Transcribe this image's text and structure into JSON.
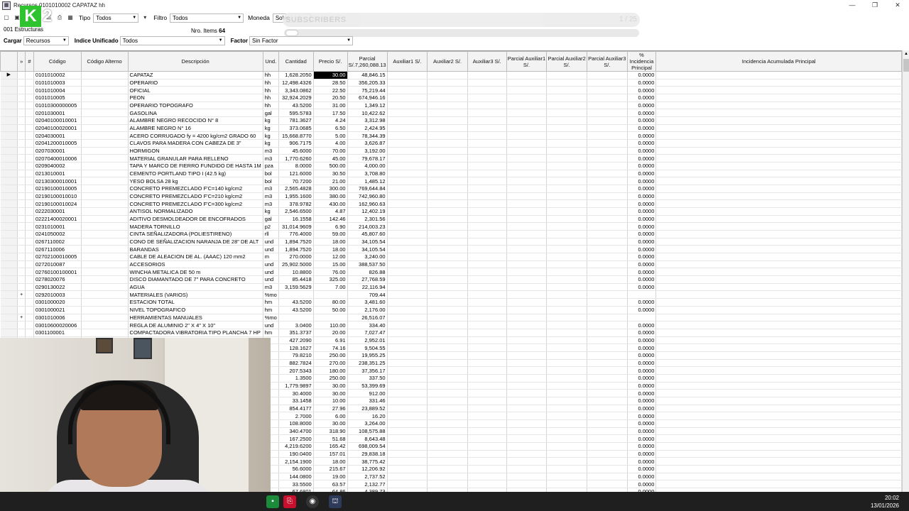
{
  "window": {
    "title": "Recursos 0101010002 CAPATAZ hh",
    "minimize": "—",
    "maximize": "❐",
    "close": "✕"
  },
  "logo": {
    "letter1": "K",
    "letter2": "2"
  },
  "toolbar": {
    "tipo_label": "Tipo",
    "tipo_value": "Todos",
    "filtro_label": "Filtro",
    "filtro_value": "Todos",
    "moneda_label": "Moneda",
    "moneda_value": "Soles"
  },
  "overlay": {
    "subscribers": "SUBSCRIBERS",
    "count": "1 / 25"
  },
  "estructuras": "001 Estructuras",
  "nro_items_label": "Nro. Items",
  "nro_items_value": "64",
  "filters": {
    "cargar_label": "Cargar",
    "cargar_value": "Recursos",
    "indice_label": "Indice Unificado",
    "indice_value": "Todos",
    "factor_label": "Factor",
    "factor_value": "Sin Factor"
  },
  "columns": [
    "»",
    "#",
    "Código",
    "Código Alterno",
    "Descripción",
    "Und.",
    "Cantidad",
    "Precio S/.",
    "Parcial S/.7,260,088.13",
    "Auxiliar1 S/.",
    "Auxiliar2 S/.",
    "Auxiliar3 S/.",
    "Parcial Auxiliar1 S/.",
    "Parcial Auxiliar2 S/.",
    "Parcial Auxiliar3 S/.",
    "% Incidencia Principal",
    "Incidencia Acumulada Principal"
  ],
  "rows": [
    {
      "exp": "",
      "code": "0101010002",
      "desc": "CAPATAZ",
      "und": "hh",
      "qty": "1,628.2050",
      "price": "30.00",
      "parcial": "48,846.15",
      "inc": "0.0000"
    },
    {
      "exp": "",
      "code": "0101010003",
      "desc": "OPERARIO",
      "und": "hh",
      "qty": "12,498.4326",
      "price": "28.50",
      "parcial": "356,205.33",
      "inc": "0.0000"
    },
    {
      "exp": "",
      "code": "0101010004",
      "desc": "OFICIAL",
      "und": "hh",
      "qty": "3,343.0862",
      "price": "22.50",
      "parcial": "75,219.44",
      "inc": "0.0000"
    },
    {
      "exp": "",
      "code": "0101010005",
      "desc": "PEON",
      "und": "hh",
      "qty": "32,924.2029",
      "price": "20.50",
      "parcial": "674,946.16",
      "inc": "0.0000"
    },
    {
      "exp": "",
      "code": "01010300000005",
      "desc": "OPERARIO TOPOGRAFO",
      "und": "hh",
      "qty": "43.5200",
      "price": "31.00",
      "parcial": "1,349.12",
      "inc": "0.0000"
    },
    {
      "exp": "",
      "code": "0201030001",
      "desc": "GASOLINA",
      "und": "gal",
      "qty": "595.5783",
      "price": "17.50",
      "parcial": "10,422.62",
      "inc": "0.0000"
    },
    {
      "exp": "",
      "code": "02040100010001",
      "desc": "ALAMBRE NEGRO RECOCIDO N° 8",
      "und": "kg",
      "qty": "781.3627",
      "price": "4.24",
      "parcial": "3,312.98",
      "inc": "0.0000"
    },
    {
      "exp": "",
      "code": "02040100020001",
      "desc": "ALAMBRE NEGRO N° 16",
      "und": "kg",
      "qty": "373.0685",
      "price": "6.50",
      "parcial": "2,424.95",
      "inc": "0.0000"
    },
    {
      "exp": "",
      "code": "0204030001",
      "desc": "ACERO CORRUGADO fy = 4200 kg/cm2 GRADO 60",
      "und": "kg",
      "qty": "15,668.8770",
      "price": "5.00",
      "parcial": "78,344.39",
      "inc": "0.0000"
    },
    {
      "exp": "",
      "code": "02041200010005",
      "desc": "CLAVOS PARA MADERA CON CABEZA DE 3\"",
      "und": "kg",
      "qty": "906.7175",
      "price": "4.00",
      "parcial": "3,626.87",
      "inc": "0.0000"
    },
    {
      "exp": "",
      "code": "0207030001",
      "desc": "HORMIGON",
      "und": "m3",
      "qty": "45.6000",
      "price": "70.00",
      "parcial": "3,192.00",
      "inc": "0.0000"
    },
    {
      "exp": "",
      "code": "02070400010006",
      "desc": "MATERIAL GRANULAR PARA RELLENO",
      "und": "m3",
      "qty": "1,770.6260",
      "price": "45.00",
      "parcial": "79,678.17",
      "inc": "0.0000"
    },
    {
      "exp": "",
      "code": "0209040002",
      "desc": "TAPA Y MARCO DE FIERRO FUNDIDO DE HASTA 1M",
      "und": "pza",
      "qty": "8.0000",
      "price": "500.00",
      "parcial": "4,000.00",
      "inc": "0.0000"
    },
    {
      "exp": "",
      "code": "0213010001",
      "desc": "CEMENTO PORTLAND TIPO I (42.5 kg)",
      "und": "bol",
      "qty": "121.6000",
      "price": "30.50",
      "parcial": "3,708.80",
      "inc": "0.0000"
    },
    {
      "exp": "",
      "code": "02130300010001",
      "desc": "YESO BOLSA 28 kg",
      "und": "bol",
      "qty": "70.7200",
      "price": "21.00",
      "parcial": "1,485.12",
      "inc": "0.0000"
    },
    {
      "exp": "",
      "code": "02190100010005",
      "desc": "CONCRETO PREMEZCLADO F'C=140 kg/cm2",
      "und": "m3",
      "qty": "2,565.4828",
      "price": "300.00",
      "parcial": "769,644.84",
      "inc": "0.0000"
    },
    {
      "exp": "",
      "code": "02190100010010",
      "desc": "CONCRETO PREMEZCLADO F'C=210 kg/cm2",
      "und": "m3",
      "qty": "1,955.1600",
      "price": "380.00",
      "parcial": "742,960.80",
      "inc": "0.0000"
    },
    {
      "exp": "",
      "code": "02190100010024",
      "desc": "CONCRETO PREMEZCLADO F'C=300 kg/cm2",
      "und": "m3",
      "qty": "378.9782",
      "price": "430.00",
      "parcial": "162,960.63",
      "inc": "0.0000"
    },
    {
      "exp": "",
      "code": "0222030001",
      "desc": "ANTISOL NORMALIZADO",
      "und": "kg",
      "qty": "2,546.6500",
      "price": "4.87",
      "parcial": "12,402.19",
      "inc": "0.0000"
    },
    {
      "exp": "",
      "code": "02221400020001",
      "desc": "ADITIVO DESMOLDEADOR DE ENCOFRADOS",
      "und": "gal",
      "qty": "16.1558",
      "price": "142.46",
      "parcial": "2,301.56",
      "inc": "0.0000"
    },
    {
      "exp": "",
      "code": "0231010001",
      "desc": "MADERA TORNILLO",
      "und": "p2",
      "qty": "31,014.9609",
      "price": "6.90",
      "parcial": "214,003.23",
      "inc": "0.0000"
    },
    {
      "exp": "",
      "code": "0241050002",
      "desc": "CINTA SEÑALIZADORA (POLIESTIRENO)",
      "und": "rll",
      "qty": "776.4000",
      "price": "59.00",
      "parcial": "45,807.60",
      "inc": "0.0000"
    },
    {
      "exp": "",
      "code": "0267110002",
      "desc": "CONO DE SEÑALIZACION NARANJA DE 28\" DE ALT",
      "und": "und",
      "qty": "1,894.7520",
      "price": "18.00",
      "parcial": "34,105.54",
      "inc": "0.0000"
    },
    {
      "exp": "",
      "code": "0267110006",
      "desc": "BARANDAS",
      "und": "und",
      "qty": "1,894.7520",
      "price": "18.00",
      "parcial": "34,105.54",
      "inc": "0.0000"
    },
    {
      "exp": "",
      "code": "02702100010005",
      "desc": "CABLE DE ALEACION DE AL. (AAAC) 120 mm2",
      "und": "m",
      "qty": "270.0000",
      "price": "12.00",
      "parcial": "3,240.00",
      "inc": "0.0000"
    },
    {
      "exp": "",
      "code": "0272010087",
      "desc": "ACCESORIOS",
      "und": "und",
      "qty": "25,902.5000",
      "price": "15.00",
      "parcial": "388,537.50",
      "inc": "0.0000"
    },
    {
      "exp": "",
      "code": "02760100100001",
      "desc": "WINCHA METALICA DE 50 m",
      "und": "und",
      "qty": "10.8800",
      "price": "76.00",
      "parcial": "826.88",
      "inc": "0.0000"
    },
    {
      "exp": "",
      "code": "0278020076",
      "desc": "DISCO DIAMANTADO DE 7\" PARA CONCRETO",
      "und": "und",
      "qty": "85.4418",
      "price": "325.00",
      "parcial": "27,768.59",
      "inc": "0.0000"
    },
    {
      "exp": "",
      "code": "0290130022",
      "desc": "AGUA",
      "und": "m3",
      "qty": "3,159.5629",
      "price": "7.00",
      "parcial": "22,116.94",
      "inc": "0.0000"
    },
    {
      "exp": "+",
      "code": "0292010003",
      "desc": "MATERIALES (VARIOS)",
      "und": "%mo",
      "qty": "",
      "price": "",
      "parcial": "709.44",
      "inc": ""
    },
    {
      "exp": "",
      "code": "0301000020",
      "desc": "ESTACION TOTAL",
      "und": "hm",
      "qty": "43.5200",
      "price": "80.00",
      "parcial": "3,481.60",
      "inc": "0.0000"
    },
    {
      "exp": "",
      "code": "0301000021",
      "desc": "NIVEL TOPOGRAFICO",
      "und": "hm",
      "qty": "43.5200",
      "price": "50.00",
      "parcial": "2,176.00",
      "inc": "0.0000"
    },
    {
      "exp": "+",
      "code": "0301010006",
      "desc": "HERRAMIENTAS MANUALES",
      "und": "%mo",
      "qty": "",
      "price": "",
      "parcial": "26,516.07",
      "inc": ""
    },
    {
      "exp": "",
      "code": "03010600020006",
      "desc": "REGLA DE ALUMINIO 2\" X 4\" X 10\"",
      "und": "und",
      "qty": "3.0400",
      "price": "110.00",
      "parcial": "334.40",
      "inc": "0.0000"
    },
    {
      "exp": "",
      "code": "0301100001",
      "desc": "COMPACTADORA VIBRATORIA TIPO PLANCHA 7 HP",
      "und": "hm",
      "qty": "351.3737",
      "price": "20.00",
      "parcial": "7,027.47",
      "inc": "0.0000"
    },
    {
      "exp": "",
      "code": "",
      "desc": "",
      "und": "",
      "qty": "427.2090",
      "price": "6.91",
      "parcial": "2,952.01",
      "inc": "0.0000"
    },
    {
      "exp": "",
      "code": "",
      "desc": "",
      "und": "",
      "qty": "128.1627",
      "price": "74.16",
      "parcial": "9,504.55",
      "inc": "0.0000"
    },
    {
      "exp": "",
      "code": "",
      "desc": "",
      "und": "",
      "qty": "79.8210",
      "price": "250.00",
      "parcial": "19,955.25",
      "inc": "0.0000"
    },
    {
      "exp": "",
      "code": "",
      "desc": "",
      "und": "",
      "qty": "882.7824",
      "price": "270.00",
      "parcial": "238,351.25",
      "inc": "0.0000"
    },
    {
      "exp": "",
      "code": "",
      "desc": "",
      "und": "",
      "qty": "207.5343",
      "price": "180.00",
      "parcial": "37,356.17",
      "inc": "0.0000"
    },
    {
      "exp": "",
      "code": "",
      "desc": "",
      "und": "",
      "qty": "1.3500",
      "price": "250.00",
      "parcial": "337.50",
      "inc": "0.0000"
    },
    {
      "exp": "",
      "code": "",
      "desc": "",
      "und": "",
      "qty": "1,779.9897",
      "price": "30.00",
      "parcial": "53,399.69",
      "inc": "0.0000"
    },
    {
      "exp": "",
      "code": "",
      "desc": "",
      "und": "",
      "qty": "30.4000",
      "price": "30.00",
      "parcial": "912.00",
      "inc": "0.0000"
    },
    {
      "exp": "",
      "code": "",
      "desc": "",
      "und": "",
      "qty": "33.1458",
      "price": "10.00",
      "parcial": "331.46",
      "inc": "0.0000"
    },
    {
      "exp": "",
      "code": "",
      "desc": "",
      "und": "",
      "qty": "854.4177",
      "price": "27.96",
      "parcial": "23,889.52",
      "inc": "0.0000"
    },
    {
      "exp": "",
      "code": "",
      "desc": "",
      "und": "",
      "qty": "2.7000",
      "price": "6.00",
      "parcial": "16.20",
      "inc": "0.0000"
    },
    {
      "exp": "",
      "code": "",
      "desc": "",
      "und": "",
      "qty": "108.8000",
      "price": "30.00",
      "parcial": "3,264.00",
      "inc": "0.0000"
    },
    {
      "exp": "",
      "code": "",
      "desc": "",
      "und": "",
      "qty": "340.4700",
      "price": "318.90",
      "parcial": "108,575.88",
      "inc": "0.0000"
    },
    {
      "exp": "",
      "code": "",
      "desc": "",
      "und": "",
      "qty": "167.2500",
      "price": "51.68",
      "parcial": "8,643.48",
      "inc": "0.0000"
    },
    {
      "exp": "",
      "code": "",
      "desc": "",
      "und": "",
      "qty": "4,219.6200",
      "price": "165.42",
      "parcial": "698,009.54",
      "inc": "0.0000"
    },
    {
      "exp": "",
      "code": "",
      "desc": "",
      "und": "",
      "qty": "190.0400",
      "price": "157.01",
      "parcial": "29,838.18",
      "inc": "0.0000"
    },
    {
      "exp": "",
      "code": "",
      "desc": "",
      "und": "",
      "qty": "2,154.1900",
      "price": "18.00",
      "parcial": "38,775.42",
      "inc": "0.0000"
    },
    {
      "exp": "",
      "code": "",
      "desc": "",
      "und": "",
      "qty": "56.6000",
      "price": "215.67",
      "parcial": "12,206.92",
      "inc": "0.0000"
    },
    {
      "exp": "",
      "code": "",
      "desc": "",
      "und": "",
      "qty": "144.0800",
      "price": "19.00",
      "parcial": "2,737.52",
      "inc": "0.0000"
    },
    {
      "exp": "",
      "code": "",
      "desc": "",
      "und": "",
      "qty": "33.5500",
      "price": "63.57",
      "parcial": "2,132.77",
      "inc": "0.0000"
    },
    {
      "exp": "",
      "code": "",
      "desc": "",
      "und": "",
      "qty": "67.6801",
      "price": "64.86",
      "parcial": "4,389.73",
      "inc": "0.0000"
    }
  ],
  "taskbar": {
    "time": "20:02",
    "date": "13/01/2026"
  }
}
